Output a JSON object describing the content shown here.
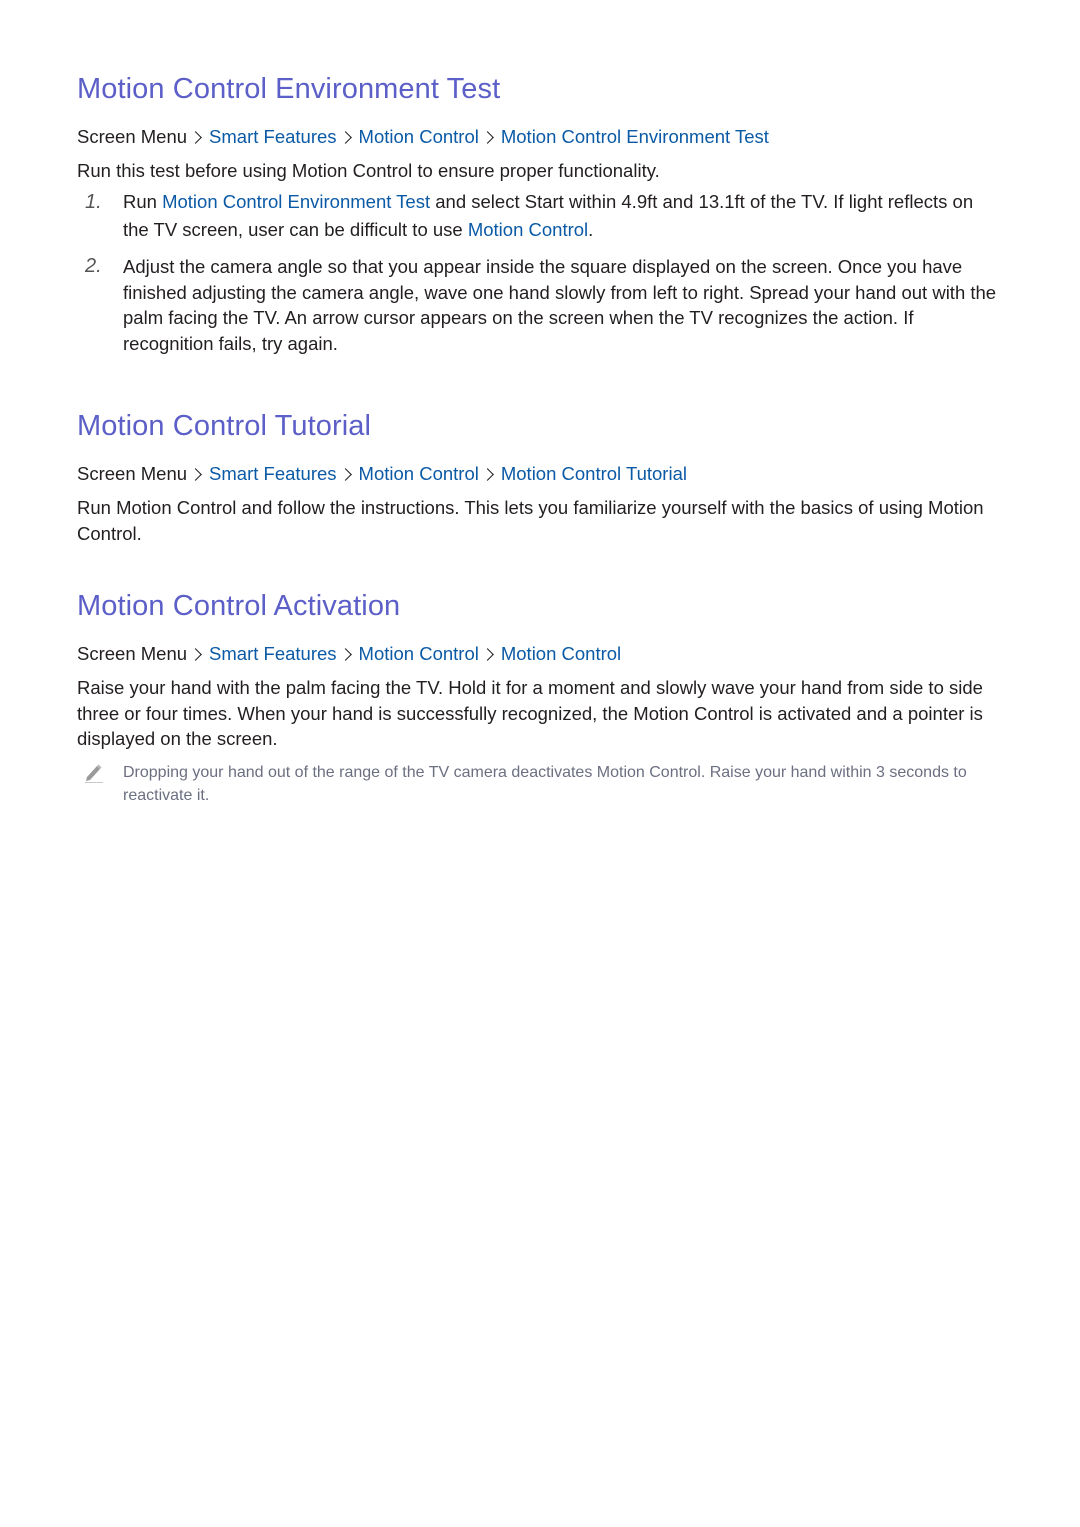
{
  "sections": [
    {
      "title": "Motion Control Environment Test",
      "breadcrumb": {
        "root": "Screen Menu",
        "links": [
          "Smart Features",
          "Motion Control",
          "Motion Control Environment Test"
        ]
      },
      "intro": "Run this test before using Motion Control to ensure proper functionality.",
      "steps": [
        {
          "number": "1.",
          "parts": [
            {
              "text": "Run ",
              "highlight": false
            },
            {
              "text": "Motion Control Environment Test",
              "highlight": true
            },
            {
              "text": " and select Start within 4.9ft and 13.1ft of the TV. If light reflects on the TV screen, user can be difficult to use ",
              "highlight": false
            },
            {
              "text": "Motion Control",
              "highlight": true
            },
            {
              "text": ".",
              "highlight": false
            }
          ]
        },
        {
          "number": "2.",
          "parts": [
            {
              "text": "Adjust the camera angle so that you appear inside the square displayed on the screen. Once you have finished adjusting the camera angle, wave one hand slowly from left to right. Spread your hand out with the palm facing the TV. An arrow cursor appears on the screen when the TV recognizes the action. If recognition fails, try again.",
              "highlight": false
            }
          ]
        }
      ]
    },
    {
      "title": "Motion Control Tutorial",
      "breadcrumb": {
        "root": "Screen Menu",
        "links": [
          "Smart Features",
          "Motion Control",
          "Motion Control Tutorial"
        ]
      },
      "body": "Run Motion Control and follow the instructions. This lets you familiarize yourself with the basics of using Motion Control."
    },
    {
      "title": "Motion Control Activation",
      "breadcrumb": {
        "root": "Screen Menu",
        "links": [
          "Smart Features",
          "Motion Control",
          "Motion Control"
        ]
      },
      "body": "Raise your hand with the palm facing the TV. Hold it for a moment and slowly wave your hand from side to side three or four times. When your hand is successfully recognized, the Motion Control is activated and a pointer is displayed on the screen.",
      "note": {
        "icon": "pencil-icon",
        "text": "Dropping your hand out of the range of the TV camera deactivates Motion Control. Raise your hand within 3 seconds to reactivate it."
      }
    }
  ],
  "colors": {
    "heading": "#5b5fc7",
    "link": "#0b5aa6",
    "text": "#231f20",
    "note": "#6b6f80"
  }
}
